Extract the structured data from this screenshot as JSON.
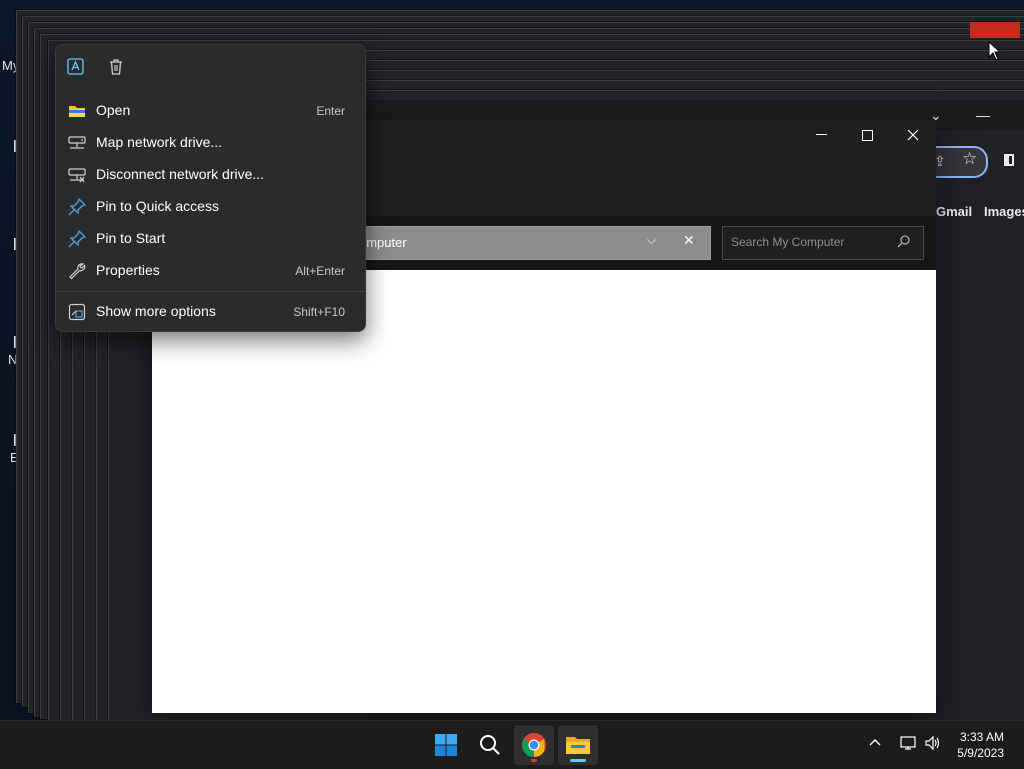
{
  "desktop": {
    "labels": [
      "My",
      "N",
      "E"
    ]
  },
  "browser": {
    "links": [
      "Gmail",
      "Images"
    ]
  },
  "explorer": {
    "address_text": "omputer",
    "search_placeholder": "Search My Computer"
  },
  "context_menu": {
    "top_icons": [
      "ai-rename-icon",
      "delete-icon"
    ],
    "items": [
      {
        "label": "Open",
        "shortcut": "Enter",
        "icon": "folder-icon"
      },
      {
        "label": "Map network drive...",
        "shortcut": "",
        "icon": "network-drive-icon"
      },
      {
        "label": "Disconnect network drive...",
        "shortcut": "",
        "icon": "disconnect-drive-icon"
      },
      {
        "label": "Pin to Quick access",
        "shortcut": "",
        "icon": "pin-icon"
      },
      {
        "label": "Pin to Start",
        "shortcut": "",
        "icon": "pin-icon"
      },
      {
        "label": "Properties",
        "shortcut": "Alt+Enter",
        "icon": "wrench-icon"
      },
      {
        "label": "Show more options",
        "shortcut": "Shift+F10",
        "icon": "more-options-icon"
      }
    ]
  },
  "taskbar": {
    "apps": [
      "start-icon",
      "search-icon",
      "chrome-icon",
      "file-explorer-icon"
    ],
    "time": "3:33 AM",
    "date": "5/9/2023"
  },
  "colors": {
    "accent": "#60cdff",
    "menu_bg": "#2b2b2b",
    "taskbar_bg": "#1c1c1c"
  }
}
